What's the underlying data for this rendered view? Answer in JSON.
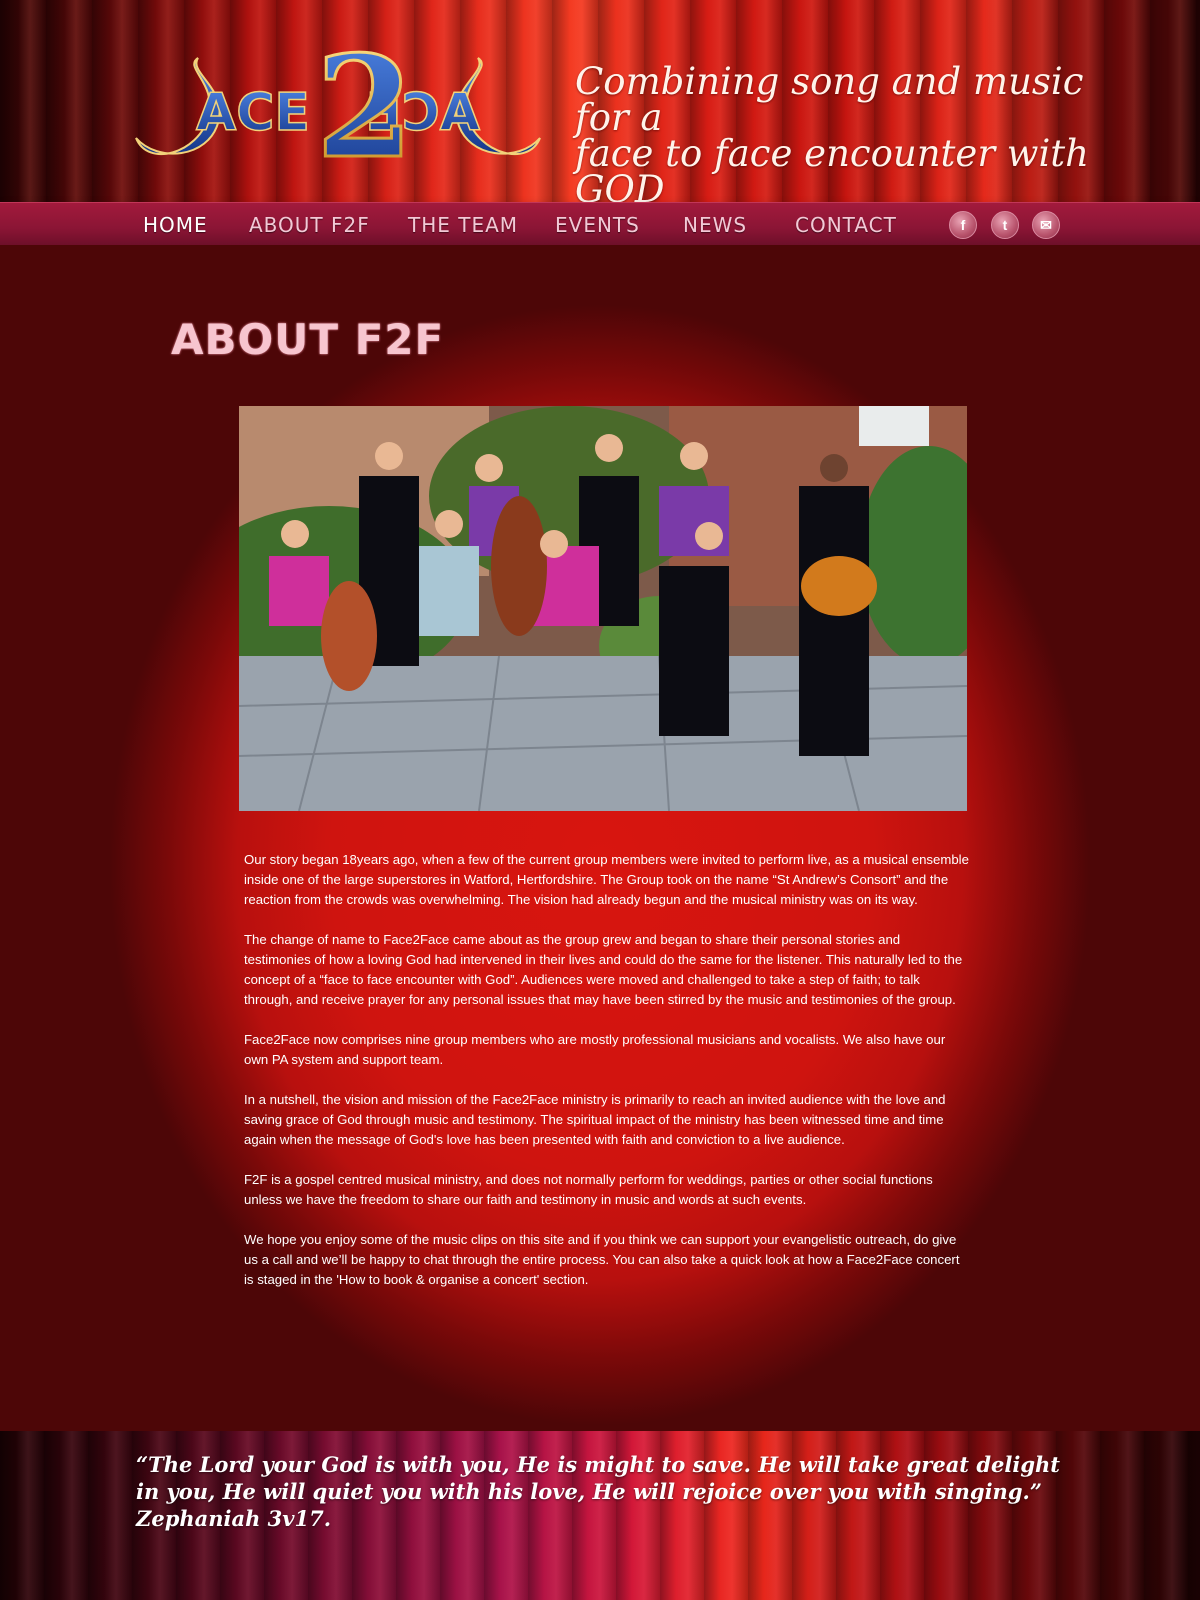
{
  "header": {
    "logo_text": "FACE2FACE",
    "tagline_line1": "Combining song and music for a",
    "tagline_line2": "face to face encounter with GOD"
  },
  "nav": {
    "items": [
      {
        "label": "HOME",
        "active": true
      },
      {
        "label": "ABOUT F2F",
        "active": false
      },
      {
        "label": "THE TEAM",
        "active": false
      },
      {
        "label": "EVENTS",
        "active": false
      },
      {
        "label": "NEWS",
        "active": false
      },
      {
        "label": "CONTACT",
        "active": false
      }
    ],
    "social": [
      {
        "icon": "facebook-icon",
        "glyph": "f"
      },
      {
        "icon": "twitter-icon",
        "glyph": "t"
      },
      {
        "icon": "mail-icon",
        "glyph": "✉"
      }
    ]
  },
  "main": {
    "title": "ABOUT F2F",
    "paragraphs": [
      "Our story began 18years ago, when a few of the current group members were invited to perform live, as a musical ensemble inside one of the large superstores in Watford, Hertfordshire. The Group took on the name “St Andrew’s Consort” and the reaction from the crowds was overwhelming. The vision had already begun and the musical ministry was on its way.",
      "The change of name to Face2Face came about as the group grew and began to share their personal stories and testimonies of how a loving God had intervened in their lives and could do the same for the listener. This naturally led to the concept of a “face to face encounter with God”.  Audiences were moved and challenged to take a step of faith; to talk through, and receive prayer for any personal issues that may have been stirred by the music and testimonies of the group.",
      "Face2Face now comprises nine group members who are mostly professional musicians and vocalists. We also have our own PA system and support team.",
      "In a nutshell, the vision and mission of the Face2Face ministry is primarily to reach an invited audience with the love and saving grace of God through music and testimony. The spiritual impact of the ministry has been witnessed time and time again when the message of God's love has been presented with faith and conviction to a live audience.",
      "F2F is a gospel centred musical ministry, and does not normally perform for weddings, parties or other social functions unless we have the freedom to share our faith and testimony in music and words at such events.",
      "We hope you enjoy some of the music clips on this site and if you think we can support your evangelistic outreach, do give us a call and we’ll be happy to chat through the entire process. You can also take a quick look at how a Face2Face concert is staged in the 'How to book & organise a concert' section."
    ]
  },
  "footer": {
    "quote": "“The Lord your God is with you, He is might to save. He will take great delight in you, He will quiet you with his love, He will rejoice over you with singing.” Zephaniah 3v17."
  },
  "colors": {
    "nav_bar": "#8b1535",
    "title_pink": "#f7c5cf",
    "logo_blue": "#1f4fa8",
    "logo_gold": "#e8b540"
  }
}
